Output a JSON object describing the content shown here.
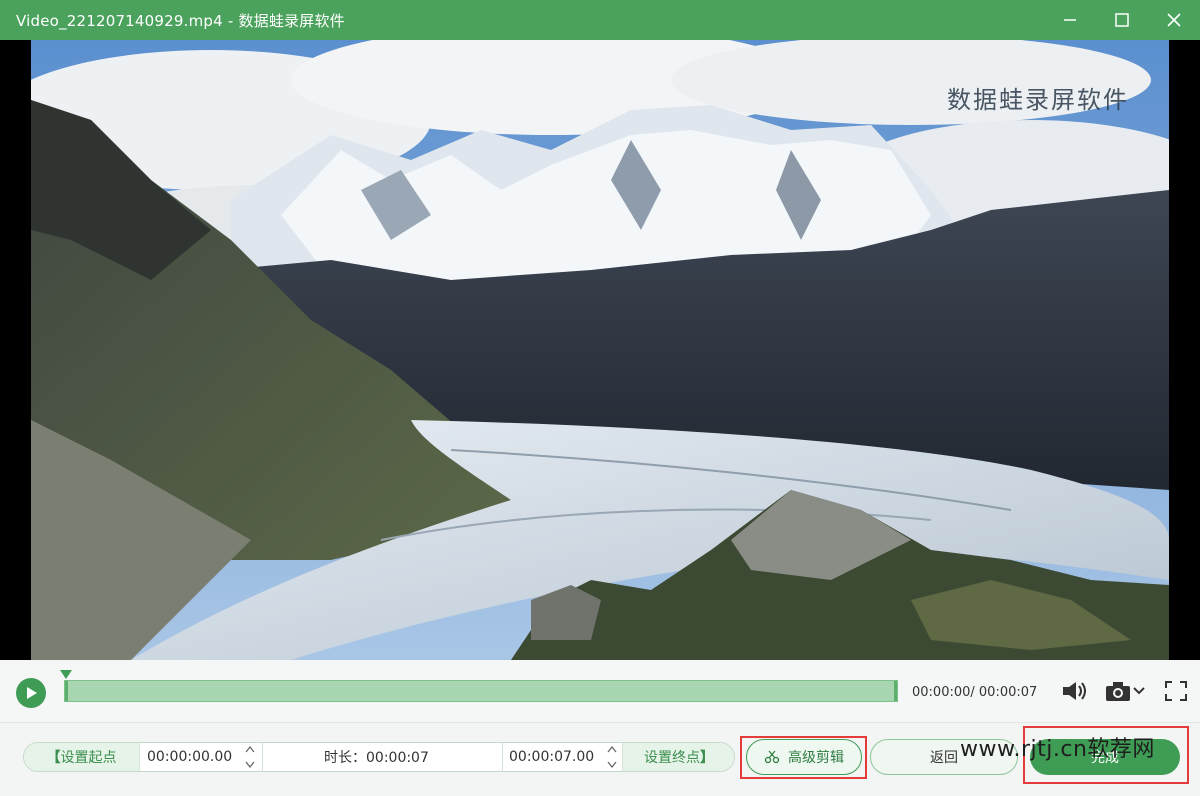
{
  "window": {
    "title": "Video_221207140929.mp4  -  数据蛙录屏软件",
    "buttons": [
      "minimize",
      "maximize",
      "close"
    ]
  },
  "video": {
    "watermark": "数据蛙录屏软件",
    "scene": "mountain-glacier-landscape"
  },
  "playback": {
    "time_readout": "00:00:00/ 00:00:07",
    "progress": 0,
    "icons": [
      "play-icon",
      "volume-icon",
      "camera-icon",
      "chevron-down-icon",
      "fullscreen-icon"
    ]
  },
  "trim": {
    "set_start_label": "设置起点",
    "start_time": "00:00:00.00",
    "duration_label": "时长：00:00:07",
    "end_time": "00:00:07.00",
    "set_end_label": "设置终点",
    "bracket_left": "【",
    "bracket_right": "】"
  },
  "actions": {
    "advanced_edit_label": "高级剪辑",
    "back_label": "返回",
    "finish_label": "完成"
  },
  "overlay": {
    "site_watermark": "www.rjtj.cn软荐网"
  },
  "colors": {
    "accent": "#4aa25c",
    "highlight": "#e53a3a"
  }
}
